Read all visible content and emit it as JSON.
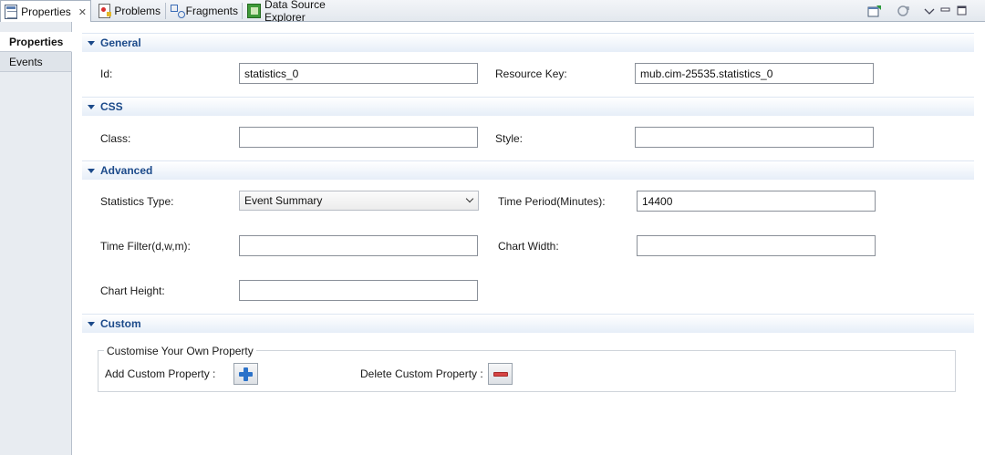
{
  "tabs": [
    {
      "label": "Properties",
      "icon": "properties-icon",
      "active": true
    },
    {
      "label": "Problems",
      "icon": "problems-icon"
    },
    {
      "label": "Fragments",
      "icon": "fragments-icon"
    },
    {
      "label": "Data Source Explorer",
      "icon": "data-source-explorer-icon"
    }
  ],
  "close_glyph": "✕",
  "nav": {
    "items": [
      {
        "label": "Properties",
        "active": true
      },
      {
        "label": "Events",
        "active": false
      }
    ]
  },
  "sections": {
    "general": {
      "title": "General",
      "id_label": "Id:",
      "id_value": "statistics_0",
      "resource_key_label": "Resource Key:",
      "resource_key_value": "mub.cim-25535.statistics_0"
    },
    "css": {
      "title": "CSS",
      "class_label": "Class:",
      "class_value": "",
      "style_label": "Style:",
      "style_value": ""
    },
    "advanced": {
      "title": "Advanced",
      "statistics_type_label": "Statistics Type:",
      "statistics_type_value": "Event Summary",
      "time_period_label": "Time Period(Minutes):",
      "time_period_value": "14400",
      "time_filter_label": "Time Filter(d,w,m):",
      "time_filter_value": "",
      "chart_width_label": "Chart Width:",
      "chart_width_value": "",
      "chart_height_label": "Chart Height:",
      "chart_height_value": ""
    },
    "custom": {
      "title": "Custom",
      "group_title": "Customise Your Own Property",
      "add_label": "Add Custom Property :",
      "delete_label": "Delete Custom Property :"
    }
  },
  "colors": {
    "section_title": "#1c4a8a",
    "add_icon": "#2b72c9",
    "delete_icon": "#d64545"
  }
}
